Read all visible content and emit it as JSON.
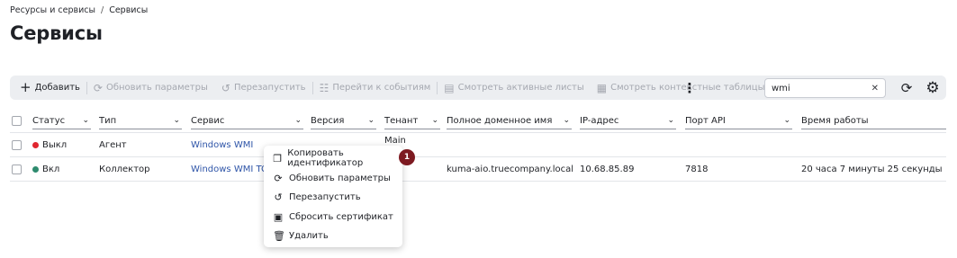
{
  "breadcrumb": {
    "parent": "Ресурсы и сервисы",
    "separator": "/",
    "current": "Сервисы"
  },
  "page_title": "Сервисы",
  "toolbar": {
    "add": "Добавить",
    "update_params": "Обновить параметры",
    "restart": "Перезапустить",
    "go_to_events": "Перейти к событиям",
    "view_active_lists": "Смотреть активные листы",
    "view_context_tables": "Смотреть контекстные таблицы",
    "search_value": "wmi",
    "icons": {
      "add": "plus-icon",
      "update": "refresh-icon",
      "restart": "restart-icon",
      "events": "events-icon",
      "lists": "list-icon",
      "tables": "table-icon",
      "more": "more-vertical-icon",
      "clear": "close-icon",
      "refresh": "refresh-icon",
      "settings": "gear-icon"
    }
  },
  "table": {
    "columns": [
      "Статус",
      "Тип",
      "Сервис",
      "Версия",
      "Тенант",
      "Полное доменное имя",
      "IP-адрес",
      "Порт API",
      "Время работы"
    ],
    "rows": [
      {
        "status": "Выкл",
        "status_color": "#e0262f",
        "type": "Агент",
        "service": "Windows WMI",
        "version": "",
        "tenant": "Main",
        "fqdn": "",
        "ip": "",
        "port": "",
        "uptime": ""
      },
      {
        "status": "Вкл",
        "status_color": "#2e8b6e",
        "type": "Коллектор",
        "service": "Windows WMI TCP",
        "version": "",
        "tenant": "",
        "fqdn": "kuma-aio.truecompany.local",
        "ip": "10.68.85.89",
        "port": "7818",
        "uptime": "20 часа 7 минуты 25 секунды"
      }
    ]
  },
  "context_menu": {
    "items": [
      {
        "label": "Копировать идентификатор",
        "icon": "copy-icon"
      },
      {
        "label": "Обновить параметры",
        "icon": "refresh-icon"
      },
      {
        "label": "Перезапустить",
        "icon": "restart-icon"
      },
      {
        "label": "Сбросить сертификат",
        "icon": "certificate-icon"
      },
      {
        "label": "Удалить",
        "icon": "trash-icon"
      }
    ]
  },
  "callout_badge": "1",
  "colors": {
    "accent_link": "#2f55a8",
    "badge": "#7d1a21",
    "toolbar_bg": "#eceef1"
  }
}
